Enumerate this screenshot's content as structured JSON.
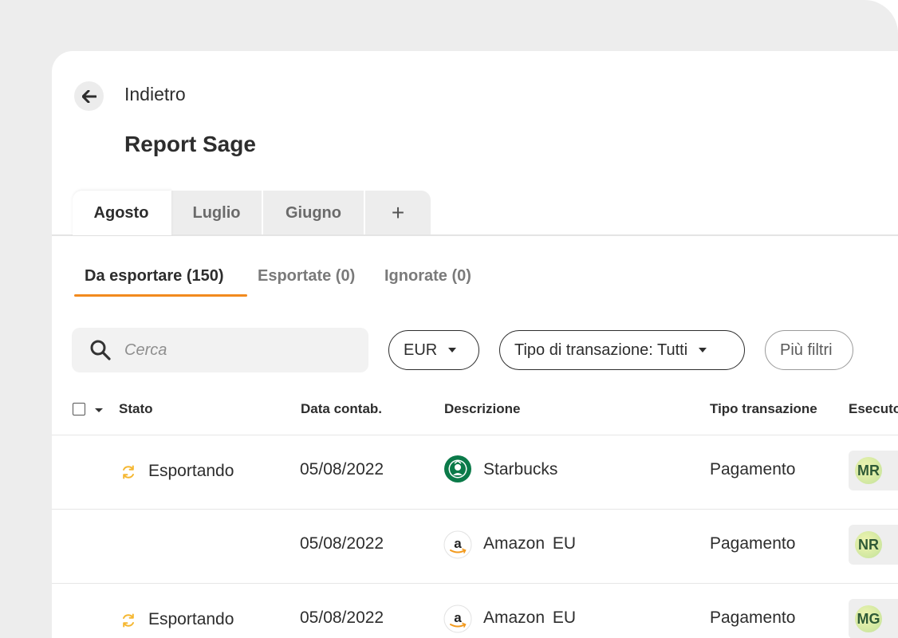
{
  "header": {
    "back_label": "Indietro",
    "title": "Report Sage"
  },
  "month_tabs": [
    {
      "label": "Agosto",
      "active": true
    },
    {
      "label": "Luglio",
      "active": false
    },
    {
      "label": "Giugno",
      "active": false
    },
    {
      "label": "+",
      "active": false
    }
  ],
  "status_tabs": [
    {
      "label": "Da esportare (150)",
      "active": true
    },
    {
      "label": "Esportate (0)",
      "active": false
    },
    {
      "label": "Ignorate (0)",
      "active": false
    }
  ],
  "filters": {
    "search_placeholder": "Cerca",
    "currency": "EUR",
    "transaction_type": "Tipo di transazione: Tutti",
    "more_filters": "Più filtri"
  },
  "table": {
    "columns": [
      "Stato",
      "Data contab.",
      "Descrizione",
      "Tipo transazione",
      "Esecutore"
    ],
    "rows": [
      {
        "status": "Esportando",
        "date": "05/08/2022",
        "description": "Starbucks",
        "logo": "starbucks-logo",
        "type": "Pagamento",
        "initials": "MR"
      },
      {
        "status": "",
        "date": "05/08/2022",
        "description": "Amazon  EU",
        "logo": "amazon-logo",
        "type": "Pagamento",
        "initials": "NR"
      },
      {
        "status": "Esportando",
        "date": "05/08/2022",
        "description": "Amazon  EU",
        "logo": "amazon-logo",
        "type": "Pagamento",
        "initials": "MG"
      }
    ]
  },
  "colors": {
    "accent_orange": "#f28a1e",
    "status_icon": "#f5b731",
    "starbucks_green": "#0b7a49",
    "avatar_text": "#2e5a36"
  }
}
